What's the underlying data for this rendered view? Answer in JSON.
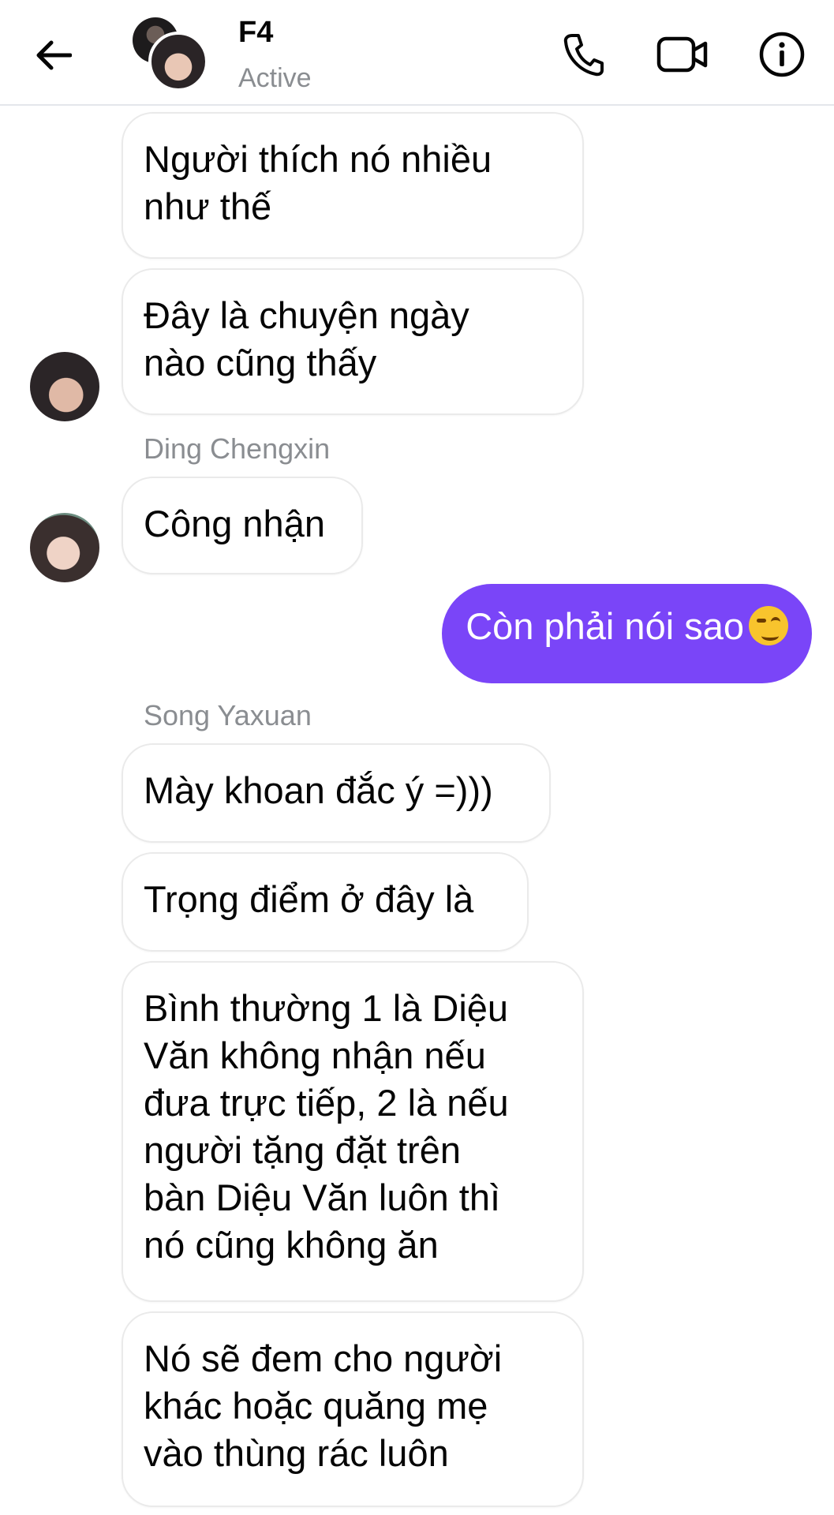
{
  "header": {
    "title": "F4",
    "status": "Active",
    "icons": {
      "back": "arrow-left-icon",
      "call": "phone-icon",
      "video": "video-camera-icon",
      "info": "info-icon"
    }
  },
  "colors": {
    "my_bubble": "#7a45f8",
    "other_bubble": "#ffffff",
    "meta_text": "#8a8d91"
  },
  "messages": [
    {
      "text": "Người thích nó nhiều\nnhư thế"
    },
    {
      "text": "Đây là chuyện ngày\nnào cũng thấy"
    },
    {
      "sender": "Ding Chengxin",
      "text": "Công nhận"
    },
    {
      "text": "Còn phải nói sao",
      "emoji": "smirking-face"
    },
    {
      "sender": "Song Yaxuan",
      "text": "Mày khoan đắc ý =)))"
    },
    {
      "text": "Trọng điểm ở đây là"
    },
    {
      "text": "Bình thường 1 là Diệu\nVăn không nhận nếu\nđưa trực tiếp, 2 là nếu\nngười tặng đặt trên\nbàn Diệu Văn luôn thì\nnó cũng không ăn"
    },
    {
      "text": "Nó sẽ đem cho người\nkhác hoặc quăng mẹ\nvào thùng rác luôn"
    }
  ]
}
